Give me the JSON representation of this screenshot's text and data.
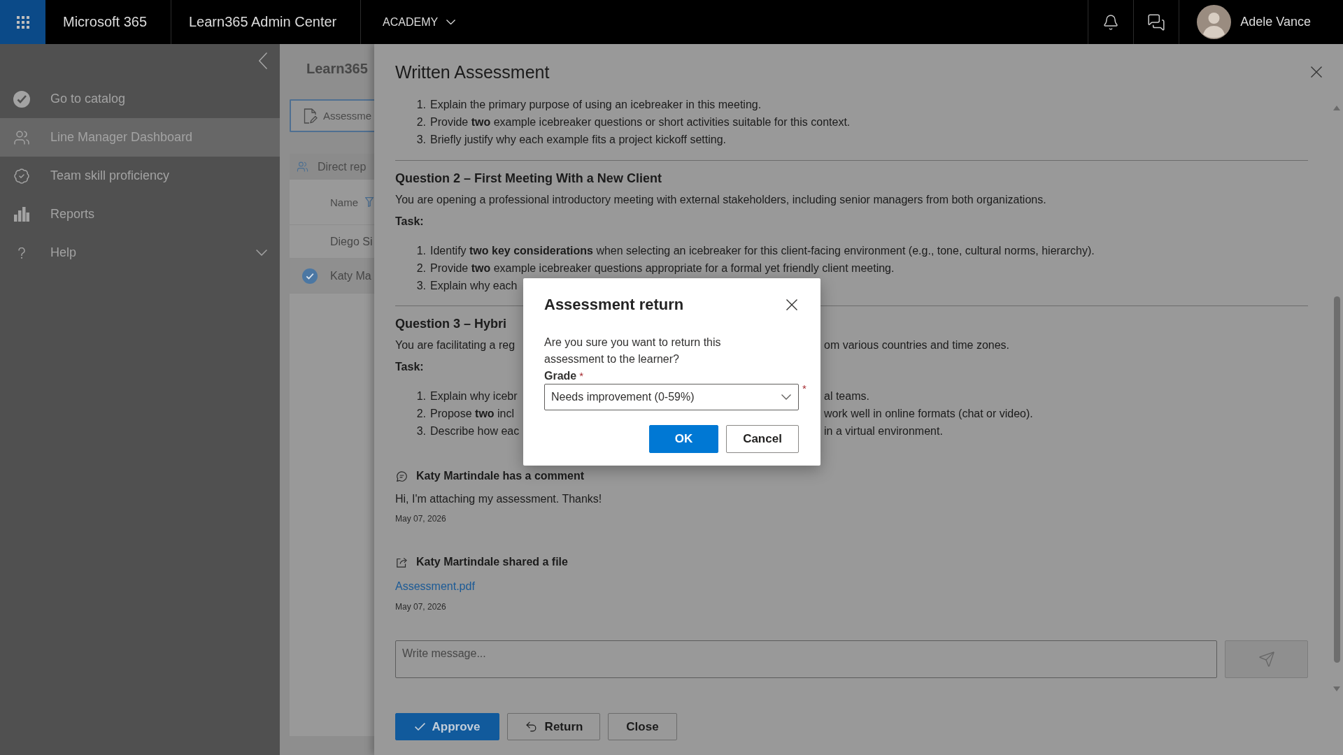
{
  "top_bar": {
    "brand": "Microsoft 365",
    "app_title": "Learn365 Admin Center",
    "tenant": "ACADEMY",
    "user_name": "Adele Vance"
  },
  "sidebar": {
    "items": [
      {
        "label": "Go to catalog",
        "selected": false
      },
      {
        "label": "Line Manager Dashboard",
        "selected": true
      },
      {
        "label": "Team skill proficiency",
        "selected": false
      },
      {
        "label": "Reports",
        "selected": false
      },
      {
        "label": "Help",
        "selected": false,
        "expanded": false
      }
    ]
  },
  "page": {
    "title": "Learn365",
    "tab": {
      "label": "Assessme",
      "selected": true
    },
    "section": "Direct rep",
    "column": "Name",
    "rows": [
      {
        "name": "Diego Si",
        "selected": false
      },
      {
        "name": "Katy Ma",
        "selected": true
      }
    ]
  },
  "panel": {
    "title": "Written Assessment",
    "task_list": [
      {
        "number": "1.",
        "parts": [
          "Explain the primary purpose of using an icebreaker in this meeting."
        ]
      },
      {
        "number": "2.",
        "parts": [
          "Provide **two** example icebreaker questions or short activities suitable for this context."
        ]
      },
      {
        "number": "3.",
        "parts": [
          "Briefly justify why each example fits a project kickoff setting."
        ]
      }
    ],
    "questions": [
      {
        "heading": "Question 2 – First Meeting With a New Client",
        "prompt": [
          "You are opening a professional introductory meeting with external stakeholders, including senior managers from both organizations."
        ],
        "task_label": "Task:",
        "tasks": [
          {
            "number": "1.",
            "parts": [
              "Identify **two key considerations** when selecting an icebreaker for this client-facing environment (e.g., tone, cultural norms, hierarchy)."
            ]
          },
          {
            "number": "2.",
            "parts": [
              "Provide **two** example icebreaker questions appropriate for a formal yet friendly client meeting."
            ]
          },
          {
            "number": "3.",
            "parts": [
              "Explain why each"
            ]
          }
        ]
      },
      {
        "heading": "Question 3 – Hybri",
        "prompt": [
          "You are facilitating a reg",
          "om various countries and time zones."
        ],
        "task_label": "Task:",
        "tasks": [
          {
            "number": "1.",
            "parts": [
              "Explain why icebr",
              "al teams."
            ]
          },
          {
            "number": "2.",
            "parts": [
              "Propose **two** incl",
              "work well in online formats (chat or video)."
            ]
          },
          {
            "number": "3.",
            "parts": [
              "Describe how eac",
              "in a virtual environment."
            ]
          }
        ]
      }
    ],
    "activity": [
      {
        "kind": "comment",
        "title": "Katy Martindale has a comment",
        "text": "Hi, I'm attaching my assessment. Thanks!",
        "date": "May 07, 2026"
      },
      {
        "kind": "file",
        "title": "Katy Martindale shared a file",
        "link": "Assessment.pdf",
        "date": "May 07, 2026"
      }
    ],
    "message": {
      "placeholder": "Write message..."
    },
    "actions": [
      {
        "label": "Approve",
        "kind": "approve"
      },
      {
        "label": "Return",
        "kind": "return"
      },
      {
        "label": "Close",
        "kind": "close"
      }
    ]
  },
  "dialog": {
    "title": "Assessment return",
    "message": "Are you sure you want to return this assessment to the learner?",
    "field": {
      "label": "Grade",
      "required_mark": "*",
      "value": "Needs improvement (0-59%)",
      "side_mark": "*"
    },
    "buttons": [
      {
        "label": "OK",
        "kind": "primary"
      },
      {
        "label": "Cancel",
        "kind": "secondary"
      }
    ]
  }
}
